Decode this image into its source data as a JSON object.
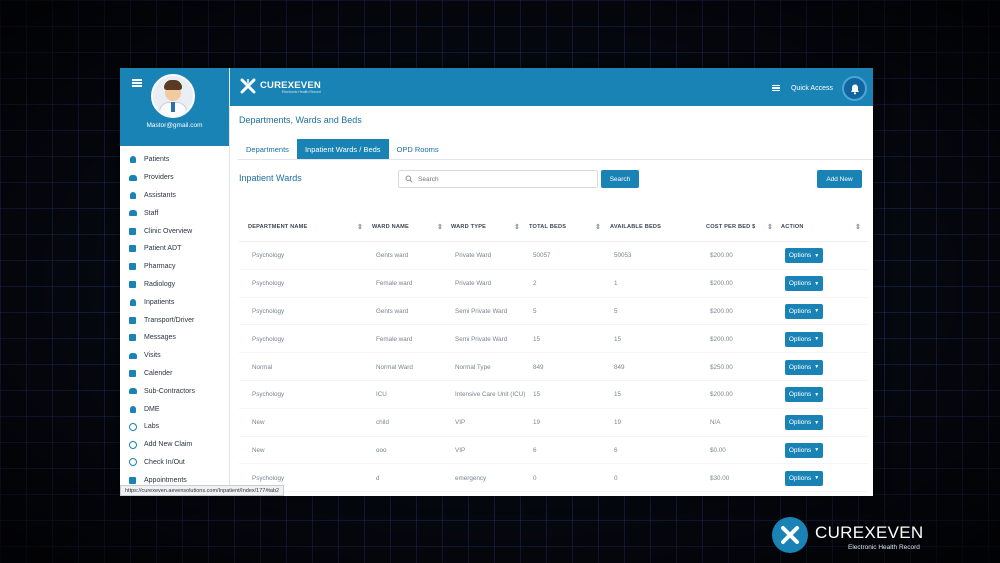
{
  "colors": {
    "accent": "#1a83b5",
    "title": "#1b6f9e"
  },
  "sidebar": {
    "email": "Mastor@gmail.com",
    "items": [
      {
        "label": "Patients",
        "icon": "person-icon"
      },
      {
        "label": "Providers",
        "icon": "people-icon"
      },
      {
        "label": "Assistants",
        "icon": "person-icon"
      },
      {
        "label": "Staff",
        "icon": "people-icon"
      },
      {
        "label": "Clinic Overview",
        "icon": "building-icon"
      },
      {
        "label": "Patient ADT",
        "icon": "bed-icon"
      },
      {
        "label": "Pharmacy",
        "icon": "pharmacy-icon"
      },
      {
        "label": "Radiology",
        "icon": "radiology-icon"
      },
      {
        "label": "Inpatients",
        "icon": "person-icon"
      },
      {
        "label": "Transport/Driver",
        "icon": "bus-icon"
      },
      {
        "label": "Messages",
        "icon": "message-icon"
      },
      {
        "label": "Visits",
        "icon": "people-icon"
      },
      {
        "label": "Calender",
        "icon": "calendar-icon"
      },
      {
        "label": "Sub-Contractors",
        "icon": "people-icon"
      },
      {
        "label": "DME",
        "icon": "wheelchair-icon"
      },
      {
        "label": "Labs",
        "icon": "circle-icon"
      },
      {
        "label": "Add New Claim",
        "icon": "circle-icon"
      },
      {
        "label": "Check In/Out",
        "icon": "circle-icon"
      },
      {
        "label": "Appointments",
        "icon": "calendar-icon"
      }
    ]
  },
  "header": {
    "logo_text": "CUREXEVEN",
    "logo_sub": "Electronic Health Record",
    "quick_access": "Quick Access"
  },
  "main": {
    "page_title": "Departments, Wards and Beds",
    "tabs": [
      {
        "label": "Departments",
        "active": false
      },
      {
        "label": "Inpatient Wards / Beds",
        "active": true
      },
      {
        "label": "OPD Rooms",
        "active": false
      }
    ],
    "section_title": "Inpatient Wards",
    "search_placeholder": "Search",
    "search_button": "Search",
    "add_button": "Add New"
  },
  "table": {
    "headers": [
      "DEPARTMENT NAME",
      "WARD NAME",
      "WARD TYPE",
      "TOTAL BEDS",
      "AVAILABLE BEDS",
      "COST PER BED $",
      "ACTION"
    ],
    "option_label": "Options",
    "rows": [
      [
        "Psychology",
        "Gents ward",
        "Private Ward",
        "50057",
        "50053",
        "$200.00"
      ],
      [
        "Psychology",
        "Female ward",
        "Private Ward",
        "2",
        "1",
        "$200.00"
      ],
      [
        "Psychology",
        "Gents ward",
        "Semi Private Ward",
        "5",
        "5",
        "$200.00"
      ],
      [
        "Psychology",
        "Female ward",
        "Semi Private Ward",
        "15",
        "15",
        "$200.00"
      ],
      [
        "Normal",
        "Normal Ward",
        "Normal Type",
        "849",
        "849",
        "$250.00"
      ],
      [
        "Psychology",
        "ICU",
        "Intensive Care Unit (ICU)",
        "15",
        "15",
        "$200.00"
      ],
      [
        "New",
        "child",
        "VIP",
        "19",
        "19",
        "N/A"
      ],
      [
        "New",
        "ooo",
        "VIP",
        "6",
        "6",
        "$0.00"
      ],
      [
        "Psychology",
        "d",
        "emergency",
        "0",
        "0",
        "$30.00"
      ]
    ]
  },
  "status_url": "https://curexeven.aevensolutions.com/Inpatient/Index/177#tab2",
  "corner_logo": {
    "text": "CUREXEVEN",
    "sub": "Electronic Health Record"
  }
}
